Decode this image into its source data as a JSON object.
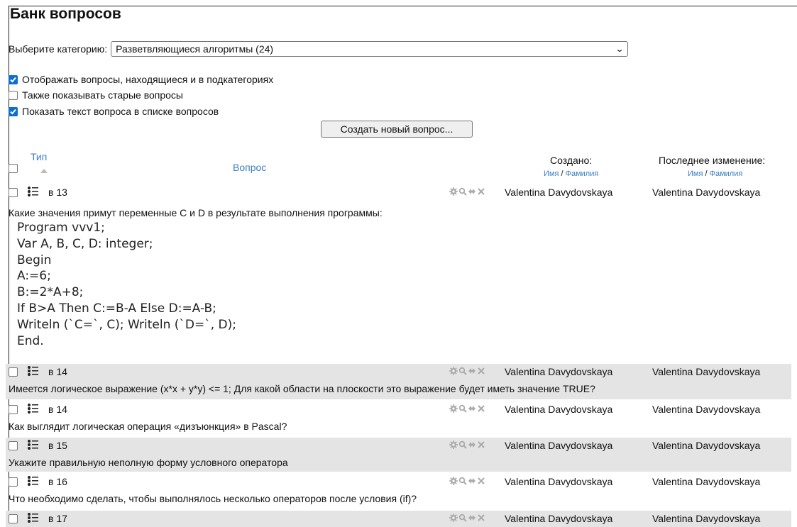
{
  "page": {
    "title": "Банк вопросов",
    "category_label": "Выберите категорию:",
    "category_value": "Разветвляющиеся алгоритмы (24)",
    "options": [
      {
        "label": "Отображать вопросы, находящиеся и в подкатегориях",
        "checked": true
      },
      {
        "label": "Также показывать старые вопросы",
        "checked": false
      },
      {
        "label": "Показать текст вопроса в списке вопросов",
        "checked": true
      }
    ],
    "create_button": "Создать новый вопрос..."
  },
  "table": {
    "col_type": "Тип",
    "col_question": "Вопрос",
    "col_created": "Создано:",
    "col_modified": "Последнее изменение:",
    "sort_first": "Имя",
    "sort_sep": " / ",
    "sort_last": "Фамилия"
  },
  "questions": [
    {
      "name": "в 13",
      "created_by": "Valentina Davydovskaya",
      "modified_by": "Valentina Davydovskaya",
      "text": "Какие значения примут переменные C и D в результате выполнения программы:",
      "code": [
        "Program vvv1;",
        "Var A, B, C, D: integer;",
        "Begin",
        "A:=6;",
        "B:=2*A+8;",
        "If B>A Then C:=B-A Else D:=A-B;",
        "Writeln (`C=`, C); Writeln (`D=`, D);",
        "End."
      ]
    },
    {
      "name": "в 14",
      "created_by": "Valentina Davydovskaya",
      "modified_by": "Valentina Davydovskaya",
      "text": "Имеется логическое выражение (x*x + y*y) <= 1; Для какой области на плоскости это выражение будет иметь значение TRUE?"
    },
    {
      "name": "в 14",
      "created_by": "Valentina Davydovskaya",
      "modified_by": "Valentina Davydovskaya",
      "text": "Как выглядит логическая операция «дизъюнкция» в Pascal?"
    },
    {
      "name": "в 15",
      "created_by": "Valentina Davydovskaya",
      "modified_by": "Valentina Davydovskaya",
      "text": "Укажите правильную неполную форму условного оператора"
    },
    {
      "name": "в 16",
      "created_by": "Valentina Davydovskaya",
      "modified_by": "Valentina Davydovskaya",
      "text": "Что необходимо сделать, чтобы выполнялось несколько операторов  после условия (if)?"
    },
    {
      "name": "в 17",
      "created_by": "Valentina Davydovskaya",
      "modified_by": "Valentina Davydovskaya",
      "text": ""
    }
  ],
  "icons": {
    "question_type": "multichoice-list-icon",
    "actions": [
      "edit-gear-icon",
      "preview-magnifier-icon",
      "move-icon",
      "delete-icon"
    ]
  }
}
